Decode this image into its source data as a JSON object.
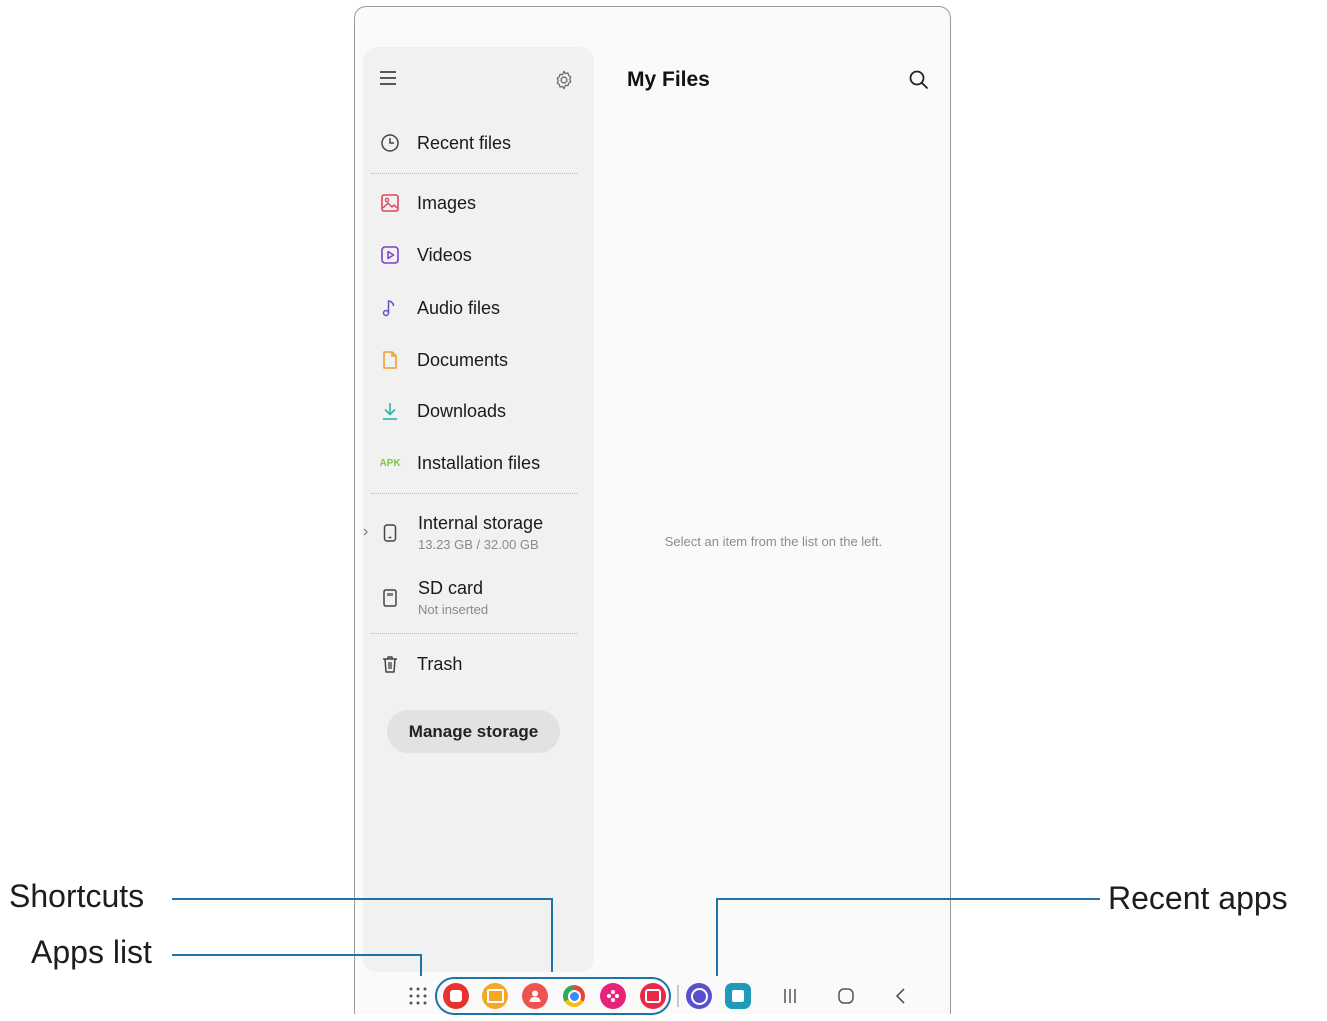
{
  "sidebar": {
    "items": [
      {
        "label": "Recent files",
        "icon": "clock-icon"
      },
      {
        "label": "Images",
        "icon": "image-icon"
      },
      {
        "label": "Videos",
        "icon": "video-icon"
      },
      {
        "label": "Audio files",
        "icon": "music-note-icon"
      },
      {
        "label": "Documents",
        "icon": "document-icon"
      },
      {
        "label": "Downloads",
        "icon": "download-icon"
      },
      {
        "label": "Installation files",
        "icon": "apk-icon",
        "icon_text": "APK"
      }
    ],
    "storage": [
      {
        "label": "Internal storage",
        "detail": "13.23 GB / 32.00 GB",
        "icon": "phone-icon"
      },
      {
        "label": "SD card",
        "detail": "Not inserted",
        "icon": "sd-card-icon"
      }
    ],
    "trash_label": "Trash",
    "manage_button": "Manage storage"
  },
  "main": {
    "title": "My Files",
    "empty_message": "Select an item from the list on the left."
  },
  "callouts": {
    "shortcuts": "Shortcuts",
    "apps_list": "Apps list",
    "recent_apps": "Recent apps"
  },
  "colors": {
    "accent_line": "#1e73a8",
    "images_icon": "#e0455a",
    "videos_icon": "#7b3fc4",
    "audio_icon": "#5b55c9",
    "documents_icon": "#f0a030",
    "downloads_icon": "#2bb3a0",
    "apk_icon": "#7ac943"
  },
  "dock": {
    "shortcuts": [
      "notes-app-icon",
      "my-files-app-icon",
      "contacts-app-icon",
      "chrome-app-icon",
      "bixby-app-icon",
      "screen-recorder-app-icon"
    ],
    "recent_apps": [
      "internet-app-icon",
      "calendar-app-icon"
    ],
    "nav": [
      "recents-nav-icon",
      "home-nav-icon",
      "back-nav-icon"
    ]
  }
}
